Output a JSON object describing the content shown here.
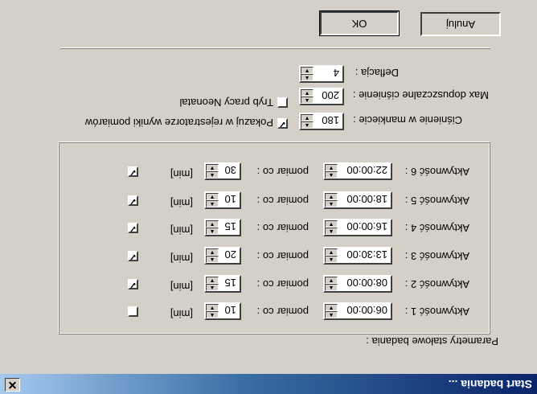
{
  "window": {
    "title": "Start badania ...",
    "close_glyph": "✕"
  },
  "group": {
    "label": "Parametry stałowe badania :"
  },
  "activities": [
    {
      "label": "Aktywność 1 :",
      "time": "06:00:00",
      "measure_label": "pomiar co :",
      "interval": "10",
      "unit": "[min]",
      "checked": false
    },
    {
      "label": "Aktywność 2 :",
      "time": "08:00:00",
      "measure_label": "pomiar co :",
      "interval": "15",
      "unit": "[min]",
      "checked": true
    },
    {
      "label": "Aktywność 3 :",
      "time": "13:30:00",
      "measure_label": "pomiar co :",
      "interval": "20",
      "unit": "[min]",
      "checked": true
    },
    {
      "label": "Aktywność 4 :",
      "time": "16:00:00",
      "measure_label": "pomiar co :",
      "interval": "15",
      "unit": "[min]",
      "checked": true
    },
    {
      "label": "Aktywność 5 :",
      "time": "18:00:00",
      "measure_label": "pomiar co :",
      "interval": "10",
      "unit": "[min]",
      "checked": true
    },
    {
      "label": "Aktywność 6 :",
      "time": "22:00:00",
      "measure_label": "pomiar co :",
      "interval": "30",
      "unit": "[min]",
      "checked": true
    }
  ],
  "settings": {
    "cuff_label": "Ciśnienie w mankiecie :",
    "cuff_value": "180",
    "maxpressure_label": "Max dopuszczalne ciśnienie :",
    "maxpressure_value": "200",
    "deflation_label": "Deflacja :",
    "deflation_value": "4"
  },
  "options": {
    "show_results_label": "Pokazuj w rejestratorze wyniki pomiarów",
    "show_results_checked": true,
    "neonatal_label": "Tryb pracy Neonatal",
    "neonatal_checked": false
  },
  "buttons": {
    "ok": "OK",
    "cancel": "Anuluj"
  }
}
